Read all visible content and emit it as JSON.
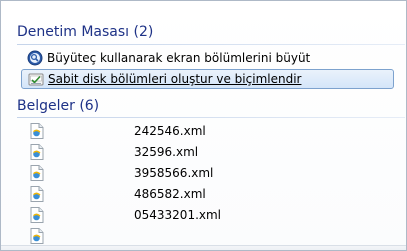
{
  "control_panel_group": {
    "header": "Denetim Masası (2)",
    "items": [
      {
        "label": "Büyüteç kullanarak ekran bölümlerini büyüt",
        "icon": "magnifier-icon",
        "selected": false
      },
      {
        "label": "Sabit disk bölümleri oluştur ve biçimlendir",
        "icon": "disk-management-icon",
        "selected": true
      }
    ]
  },
  "documents_group": {
    "header": "Belgeler (6)",
    "files": [
      {
        "name": "242546.xml",
        "icon": "xml-file-icon"
      },
      {
        "name": "32596.xml",
        "icon": "xml-file-icon"
      },
      {
        "name": "3958566.xml",
        "icon": "xml-file-icon"
      },
      {
        "name": "486582.xml",
        "icon": "xml-file-icon"
      },
      {
        "name": "05433201.xml",
        "icon": "xml-file-icon"
      },
      {
        "name": "",
        "icon": "xml-file-icon"
      }
    ]
  },
  "colors": {
    "header_text": "#1e3287",
    "selection_border": "#7da2ce",
    "selection_fill": "#d4e5f9"
  }
}
